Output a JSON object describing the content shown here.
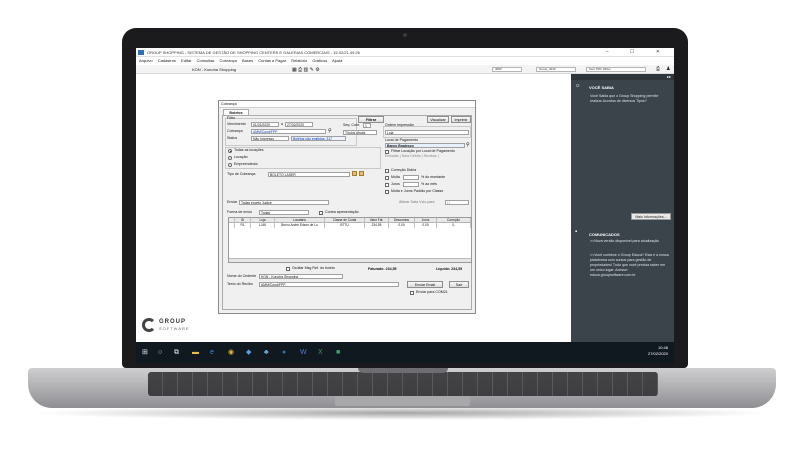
{
  "app": {
    "title": "GROUP SHOPPING - SISTEMA DE GESTÃO DE SHOPPING CENTERS E GALERIAS COMERCIAIS - 15.02/21.49.26",
    "window_controls": "–  ☐  ✕",
    "menu": [
      "Arquivo",
      "Cadastros",
      "Editar",
      "Consultas",
      "Cobrança",
      "Bases",
      "Contas a Pagar",
      "Relatório",
      "Gráficos",
      "Ajuda"
    ],
    "store": "KON - Konoha Shopping",
    "toolbar_fields": [
      "4050",
      "Group_4010",
      "Sem PDF Writer"
    ]
  },
  "dialog": {
    "title": "Cobrança",
    "tab": "Boletos",
    "filtro_label": "Filtro",
    "vencimento_label": "Vencimento",
    "vencimento_de": "01/01/2020",
    "vencimento_a_label": "a",
    "vencimento_ate": "27/02/2020",
    "seq_cobr_label": "Seq. Cobr.",
    "seq_cobr_value": "1",
    "cobranca_label": "Cobrança",
    "cobranca_value": "AMM/Cond/FPP",
    "titulos_value": "Títulos Atuais",
    "status_label": "Status",
    "status_value": "Não Impresso",
    "status_note": "Boletos não emitidos: 317",
    "filtrar_button": "Filtrar",
    "visualizar_button": "Visualizar",
    "imprimir_button": "Imprimir",
    "ordem_label": "Ordem Impressão",
    "ordem_value": "Loja",
    "local_pagamento_label": "Local de Pagamento",
    "local_pagamento_value": "Banco Bradesco",
    "filtrar_locacao_label": "Filtrar Locação por Local de Pagamento",
    "emissao_label": "Emissão | Nota Débito | Recibos |",
    "locacoes_options": [
      "Todas as locações",
      "Locação",
      "Empreendedor"
    ],
    "tipo_cobranca_label": "Tipo de Cobrança",
    "tipo_cobranca_value": "BOLETO LASER",
    "correcao_label": "Correção Diária",
    "multa_label": "Multa",
    "multa_suffix": "% do montante",
    "juros_label": "Juros",
    "juros_suffix": "% ao mês",
    "multa_juros_padrao_label": "Multa e Juros Padrão por Classe",
    "enviar_label": "Enviar",
    "enviar_value": "Todas exceto Judice",
    "alterar_data_label": "Alterar Data Vcto para",
    "alterar_data_value": "/ /",
    "forma_envio_label": "Forma de envio",
    "forma_envio_value": "Todas",
    "contra_apresentacao_label": "Contra apresentação",
    "grid_headers": [
      "",
      "ID",
      "Loja",
      "Locatário",
      "Classe de Conta",
      "Valor Fat.",
      "Descontos",
      "Juros",
      "Correção"
    ],
    "grid_rows": [
      [
        "",
        "R1",
        "LJ46",
        "Bruno André Edson de Lu",
        "BTTU",
        "234,55",
        "0,00",
        "0,00",
        "0,"
      ]
    ],
    "ocultar_label": "Ocultar Msg Ref. do boleto",
    "faturado_label": "Faturado: 234,55",
    "liquido_label": "Líquido: 234,55",
    "nome_cedente_label": "Nome do Cedente",
    "nome_cedente_value": "KON - Konoha Shopping",
    "texto_recibo_label": "Texto do Recibo",
    "texto_recibo_value": "AMM/Cond/FPP",
    "enviar_email_button": "Enviar Email",
    "sair_button": "Sair",
    "enviar_com21_label": "Enviar para COM21"
  },
  "side_panel": {
    "voce_sabia_title": "VOCÊ SABIA",
    "voce_sabia_text": "Você Sabia que o Group Shopping permite realizar Acordos de diversos Tipos?",
    "mais_info_button": "Mais Informações...",
    "comunicados_title": "COMUNICADOS",
    "comunicados_text_1": ">>Nova versão disponível para atualização",
    "comunicados_text_2": ">>Você conhece o Group Educa? Esta é a nossa plataforma com cursos para gestão de propriedades! Tudo que você precisa saber em um único lugar. Acesse: educa.groupsoftware.com.br"
  },
  "logo": {
    "line1": "GROUP",
    "line2": "SOFTWARE"
  },
  "taskbar": {
    "time": "10:48",
    "date": "27/02/2020"
  },
  "colors": {
    "panel": "#3b434b",
    "taskbar": "#101820",
    "accent": "#0033aa"
  }
}
